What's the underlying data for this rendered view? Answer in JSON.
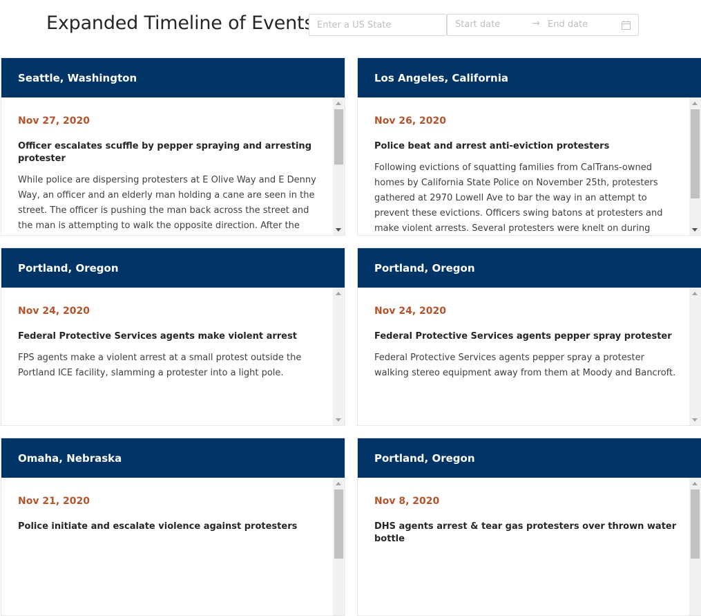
{
  "header": {
    "title": "Expanded Timeline of Events",
    "state_placeholder": "Enter a US State",
    "start_placeholder": "Start date",
    "range_separator": "→",
    "end_placeholder": "End date"
  },
  "cards": [
    {
      "location": "Seattle, Washington",
      "date": "Nov 27, 2020",
      "headline": "Officer escalates scuffle by pepper spraying and arresting protester",
      "description": "While police are dispersing protesters at E Olive Way and E Denny Way, an officer and an elderly man holding a cane are seen in the street. The officer is pushing the man back across the street and the man is attempting to walk the opposite direction. After the officer pushes the protester to the sidewalk, the officer turns to walk away."
    },
    {
      "location": "Los Angeles, California",
      "date": "Nov 26, 2020",
      "headline": "Police beat and arrest anti-eviction protesters",
      "description": "Following evictions of squatting families from CalTrans-owned homes by California State Police on November 25th, protesters gathered at 2970 Lowell Ave to bar the way in an attempt to prevent these evictions. Officers swing batons at protesters and make violent arrests. Several protesters were knelt on during arrests; some were"
    },
    {
      "location": "Portland, Oregon",
      "date": "Nov 24, 2020",
      "headline": "Federal Protective Services agents make violent arrest",
      "description": "FPS agents make a violent arrest at a small protest outside the Portland ICE facility, slamming a protester into a light pole."
    },
    {
      "location": "Portland, Oregon",
      "date": "Nov 24, 2020",
      "headline": "Federal Protective Services agents pepper spray protester",
      "description": "Federal Protective Services agents pepper spray a protester walking stereo equipment away from them at Moody and Bancroft."
    },
    {
      "location": "Omaha, Nebraska",
      "date": "Nov 21, 2020",
      "headline": "Police initiate and escalate violence against protesters",
      "description": ""
    },
    {
      "location": "Portland, Oregon",
      "date": "Nov 8, 2020",
      "headline": "DHS agents arrest & tear gas protesters over thrown water bottle",
      "description": ""
    }
  ]
}
